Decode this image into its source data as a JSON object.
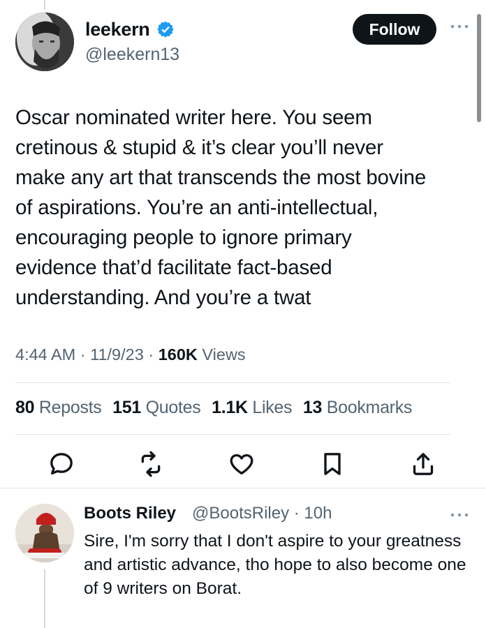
{
  "tweet": {
    "author_name": "leekern",
    "author_handle": "@leekern13",
    "follow_label": "Follow",
    "text": "Oscar nominated writer here. You seem\ncretinous & stupid & it’s clear you’ll never\nmake any art that transcends the most bovine\nof aspirations. You’re an anti-intellectual,\nencouraging people to ignore primary\nevidence that’d facilitate fact-based\nunderstanding. And you’re a twat",
    "time": "4:44 AM",
    "date": "11/9/23",
    "views_count": "160K",
    "views_label": "Views"
  },
  "stats": {
    "reposts_count": "80",
    "reposts_label": "Reposts",
    "quotes_count": "151",
    "quotes_label": "Quotes",
    "likes_count": "1.1K",
    "likes_label": "Likes",
    "bookmarks_count": "13",
    "bookmarks_label": "Bookmarks"
  },
  "actions": [
    "reply-icon",
    "repost-icon",
    "like-icon",
    "bookmark-icon",
    "share-icon"
  ],
  "reply": {
    "author_name": "Boots Riley",
    "author_handle": "@BootsRiley",
    "age": "10h",
    "text": "Sire, I'm sorry that I don't aspire to your greatness and artistic advance, tho hope to also become one of 9 writers on Borat."
  },
  "colors": {
    "accent": "#1d9bf0",
    "text": "#0f1419",
    "secondary": "#536471",
    "follow_bg": "#0f1419"
  }
}
